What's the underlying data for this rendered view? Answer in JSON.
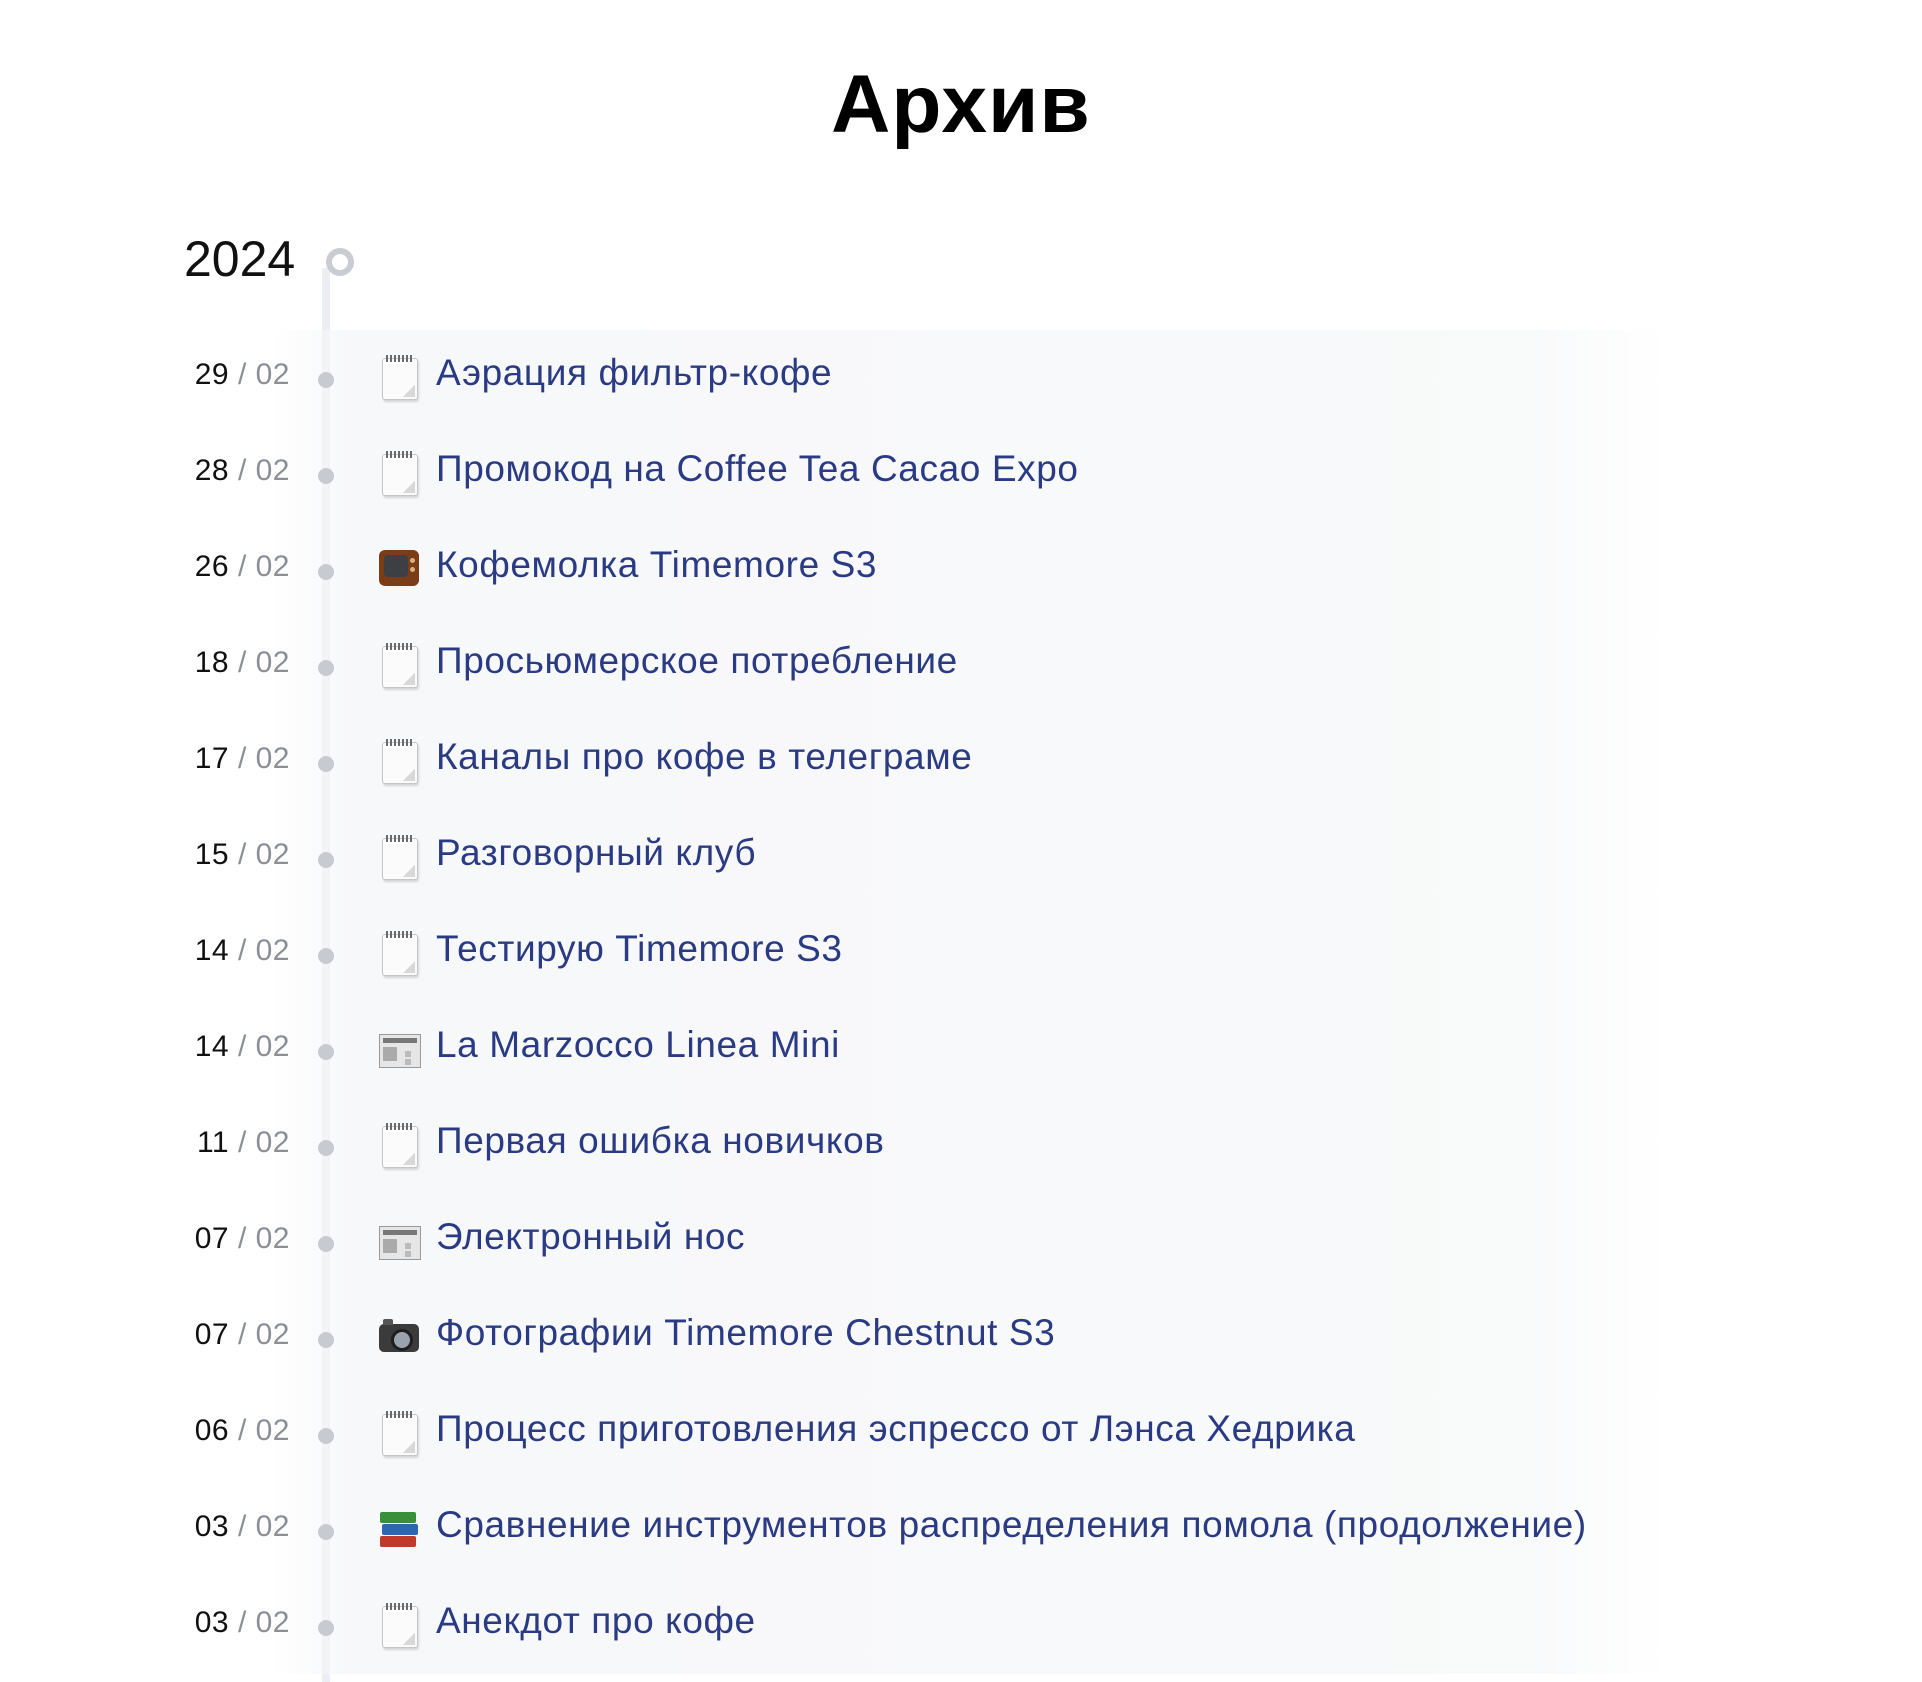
{
  "page": {
    "title": "Архив"
  },
  "archive": {
    "year": "2024",
    "entries": [
      {
        "day": "29",
        "month": "02",
        "icon": "notepad-icon",
        "title": "Аэрация фильтр-кофе"
      },
      {
        "day": "28",
        "month": "02",
        "icon": "notepad-icon",
        "title": "Промокод на Coffee Tea Cacao Expo"
      },
      {
        "day": "26",
        "month": "02",
        "icon": "tv-icon",
        "title": "Кофемолка Timemore S3"
      },
      {
        "day": "18",
        "month": "02",
        "icon": "notepad-icon",
        "title": "Просьюмерское потребление"
      },
      {
        "day": "17",
        "month": "02",
        "icon": "notepad-icon",
        "title": "Каналы про кофе в телеграме"
      },
      {
        "day": "15",
        "month": "02",
        "icon": "notepad-icon",
        "title": "Разговорный клуб"
      },
      {
        "day": "14",
        "month": "02",
        "icon": "notepad-icon",
        "title": "Тестирую Timemore S3"
      },
      {
        "day": "14",
        "month": "02",
        "icon": "newspaper-icon",
        "title": "La Marzocco Linea Mini"
      },
      {
        "day": "11",
        "month": "02",
        "icon": "notepad-icon",
        "title": "Первая ошибка новичков"
      },
      {
        "day": "07",
        "month": "02",
        "icon": "newspaper-icon",
        "title": "Электронный нос"
      },
      {
        "day": "07",
        "month": "02",
        "icon": "camera-icon",
        "title": "Фотографии Timemore Chestnut S3"
      },
      {
        "day": "06",
        "month": "02",
        "icon": "notepad-icon",
        "title": "Процесс приготовления эспрессо от Лэнса Хедрика"
      },
      {
        "day": "03",
        "month": "02",
        "icon": "books-icon",
        "title": "Сравнение инструментов распределения помола (продолжение)"
      },
      {
        "day": "03",
        "month": "02",
        "icon": "notepad-icon",
        "title": "Анекдот про кофе"
      }
    ]
  },
  "colors": {
    "link": "#2a3b84",
    "timeline": "#eceef1",
    "dot": "#c7cad0",
    "month": "#8a8f98"
  }
}
